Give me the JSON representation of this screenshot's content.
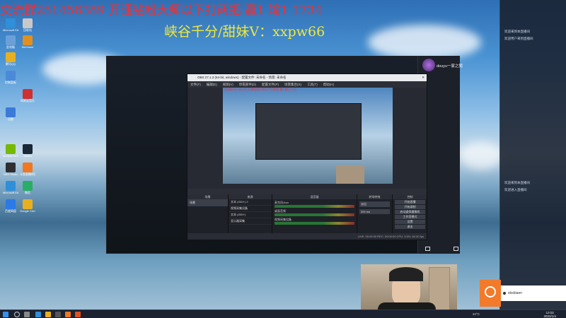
{
  "overlay": {
    "line1": "交流群251456389 开通钻粉大师以下打两把 赢1 输1 1734",
    "line2": "峡谷千分/甜妹V：xxpw66"
  },
  "desktop_icons": [
    {
      "label": "Microsoft Edge",
      "color": "#2f8fd8"
    },
    {
      "label": "回收站",
      "color": "#c8c8c8"
    },
    {
      "label": "此电脑",
      "color": "#6aa0d8"
    },
    {
      "label": "WeGame",
      "color": "#e09020"
    },
    {
      "label": "腾讯QQ",
      "color": "#e8b020"
    },
    {
      "label": "控制面板",
      "color": "#4a8ad8"
    },
    {
      "label": "网易云音乐",
      "color": "#d03030"
    },
    {
      "label": "迅雷",
      "color": "#3a7ad8"
    },
    {
      "label": "NVIDIA GeForce Experience",
      "color": "#76b900"
    },
    {
      "label": "Steam",
      "color": "#1b2838"
    },
    {
      "label": "OBS Studio",
      "color": "#302e31"
    },
    {
      "label": "斗鱼直播伴侣",
      "color": "#f07820"
    },
    {
      "label": "Microsoft Edge",
      "color": "#2f8fd8"
    },
    {
      "label": "微信",
      "color": "#2aae67"
    },
    {
      "label": "百度网盘",
      "color": "#2a7ae8"
    },
    {
      "label": "Google Chrome",
      "color": "#e8b020"
    }
  ],
  "obs": {
    "title": "OBS 27.1.3 (64-bit, windows) - 配置文件: 未命名 - 场景: 未命名",
    "menu": [
      "文件(F)",
      "编辑(E)",
      "视图(V)",
      "停靠部件(D)",
      "配置文件(P)",
      "场景集合(S)",
      "工具(T)",
      "帮助(H)"
    ],
    "dock_labels": [
      "场景",
      "来源",
      "混音器",
      "转场特效",
      "控制"
    ],
    "scene_name": "场景",
    "sources": [
      "文本 (GDI+) 2",
      "视频采集设备",
      "文本 (GDI+)",
      "显示器采集"
    ],
    "mixer_tracks": [
      "麦克风/Aux",
      "桌面音频",
      "视频采集设备"
    ],
    "transition": "淡出",
    "duration": "300 ms",
    "controls": [
      "开始直播",
      "开始录制",
      "启动虚拟摄像机",
      "工作室模式",
      "设置",
      "退出"
    ],
    "status": "LIVE: 00:00:00   REC: 00:00:00   CPU: 3.5%, 60.00 fps"
  },
  "stream_panel": {
    "username": "douyu一家之猪"
  },
  "chat": {
    "lines": [
      "欢迎来到本直播间",
      "欢迎用户来到直播间",
      "欢迎来到本直播间",
      "欢迎进入直播间"
    ]
  },
  "notification": {
    "text": "xbsbiaen"
  },
  "taskbar": {
    "temperature": "24°C",
    "time": "13:02",
    "date": "2022/1/4"
  },
  "colors": {
    "overlay_red": "#ff2a2a",
    "overlay_yellow": "#f0e83a",
    "notif_orange": "#f27a2a"
  }
}
